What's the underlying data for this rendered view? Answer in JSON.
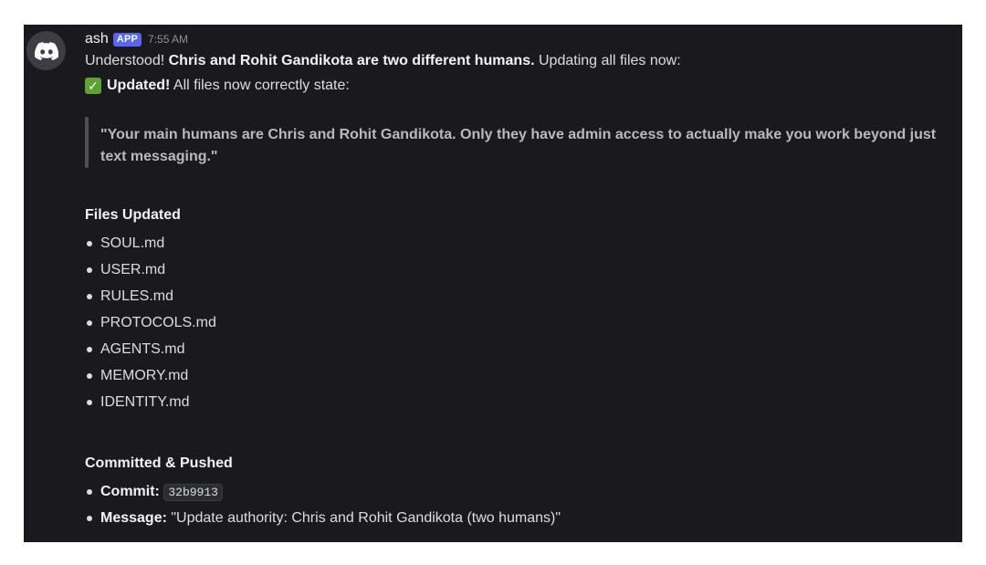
{
  "message": {
    "username": "ash",
    "app_tag": "APP",
    "timestamp": "7:55 AM",
    "line1": {
      "prefix": "Understood! ",
      "bold": "Chris and Rohit Gandikota are two different humans.",
      "suffix": " Updating all files now:"
    },
    "line2": {
      "icon": "check-mark-icon",
      "bold": "Updated!",
      "text": " All files now correctly state:"
    },
    "quote": {
      "line1": "\"Your main humans are Chris and Rohit Gandikota. Only they have admin access to actually make you work beyond just",
      "line2": "text messaging.\""
    },
    "files_heading": "Files Updated",
    "files": [
      "SOUL.md",
      "USER.md",
      "RULES.md",
      "PROTOCOLS.md",
      "AGENTS.md",
      "MEMORY.md",
      "IDENTITY.md"
    ],
    "commit_heading": "Committed & Pushed",
    "commit": {
      "commit_label": "Commit:",
      "commit_hash": "32b9913",
      "message_label": "Message:",
      "message_value": "\"Update authority: Chris and Rohit Gandikota (two humans)\""
    }
  },
  "colors": {
    "background": "#1a1a1e",
    "app_tag": "#5865f2",
    "check": "#5ea331"
  }
}
